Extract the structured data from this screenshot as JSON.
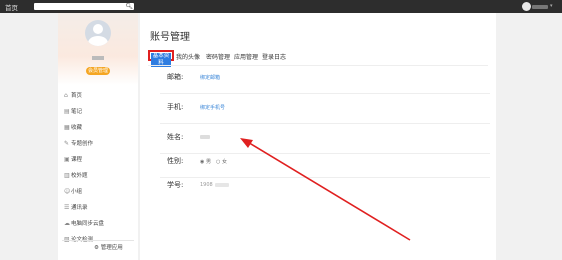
{
  "topbar": {
    "home": "首页",
    "search_placeholder": ""
  },
  "sidebar": {
    "badge": "会员管理",
    "items": [
      {
        "label": "首页",
        "icon": "home-icon",
        "glyph": "⌂"
      },
      {
        "label": "笔记",
        "icon": "note-icon",
        "glyph": "▤"
      },
      {
        "label": "收藏",
        "icon": "favorite-icon",
        "glyph": "▦"
      },
      {
        "label": "专题创作",
        "icon": "topic-icon",
        "glyph": "✎"
      },
      {
        "label": "课程",
        "icon": "course-icon",
        "glyph": "▣"
      },
      {
        "label": "校外题",
        "icon": "exercise-icon",
        "glyph": "▥"
      },
      {
        "label": "小组",
        "icon": "group-icon",
        "glyph": "☺"
      },
      {
        "label": "通讯录",
        "icon": "contacts-icon",
        "glyph": "☰"
      },
      {
        "label": "电脑同步云盘",
        "icon": "cloud-icon",
        "glyph": "☁"
      },
      {
        "label": "论文检测",
        "icon": "paper-check-icon",
        "glyph": "▧"
      }
    ],
    "manage": "管理应用"
  },
  "main": {
    "title": "账号管理",
    "tabs": [
      "基本资料",
      "我的头像",
      "密码管理",
      "应用管理",
      "登录日志"
    ],
    "fields": {
      "email_label": "邮箱:",
      "email_value": "绑定邮箱",
      "phone_label": "手机:",
      "phone_value": "绑定手机号",
      "name_label": "姓名:",
      "gender_label": "性别:",
      "gender_male": "男",
      "gender_female": "女",
      "id_label": "学号:",
      "id_value": "1908"
    }
  },
  "colors": {
    "accent": "#2f7de1",
    "highlight": "#e02020",
    "badge": "#f5a623"
  }
}
